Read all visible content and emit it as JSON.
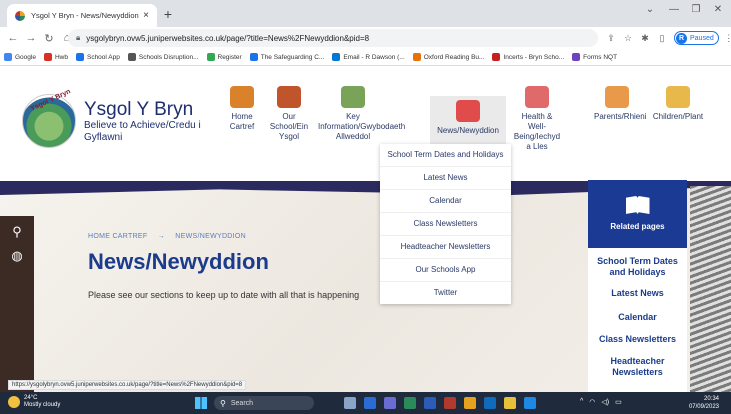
{
  "browser": {
    "tab_title": "Ysgol Y Bryn - News/Newyddion",
    "tab_close": "×",
    "new_tab": "+",
    "url": "ysgolybryn.ovw5.juniperwebsites.co.uk/page/?title=News%2FNewyddion&pid=8",
    "profile_initial": "R",
    "profile_status": "Paused",
    "win_minimize": "—",
    "win_restore": "❐",
    "win_close": "✕",
    "win_chevron": "⌄"
  },
  "bookmarks": [
    {
      "label": "Google",
      "color": "#4285f4"
    },
    {
      "label": "Hwb",
      "color": "#d93025"
    },
    {
      "label": "School App",
      "color": "#1a73e8"
    },
    {
      "label": "Schools Disruption...",
      "color": "#555555"
    },
    {
      "label": "Register",
      "color": "#34a853"
    },
    {
      "label": "The Safeguarding C...",
      "color": "#1a73e8"
    },
    {
      "label": "Email - R Dawson (...",
      "color": "#0078d4"
    },
    {
      "label": "Oxford Reading Bu...",
      "color": "#e8710a"
    },
    {
      "label": "Incerts - Bryn Scho...",
      "color": "#c5221f"
    },
    {
      "label": "Forms NQT",
      "color": "#6f42c1"
    }
  ],
  "school": {
    "name": "Ysgol Y Bryn",
    "motto": "Believe to Achieve/Credu i Gyflawni",
    "logo_text": "Ysgol Y Bryn"
  },
  "nav": [
    {
      "label": "Home Cartref",
      "icon": "house-icon",
      "color": "#d9822b"
    },
    {
      "label": "Our School/Ein Ysgol",
      "icon": "school-icon",
      "color": "#c0552b"
    },
    {
      "label": "Key Information/Gwybodaeth Allweddol",
      "icon": "document-icon",
      "color": "#7aa35a"
    },
    {
      "label": "News/Newyddion",
      "icon": "newspaper-icon",
      "color": "#e04b4b"
    },
    {
      "label": "Health & Well-Being/Iechyd a Lles",
      "icon": "heart-hand-icon",
      "color": "#e06a6a"
    },
    {
      "label": "Parents/Rhieni",
      "icon": "parents-icon",
      "color": "#e89a4a"
    },
    {
      "label": "Children/Plant",
      "icon": "children-icon",
      "color": "#e8b84a"
    }
  ],
  "dropdown": [
    "School Term Dates and Holidays",
    "Latest News",
    "Calendar",
    "Class Newsletters",
    "Headteacher Newsletters",
    "Our Schools App",
    "Twitter"
  ],
  "breadcrumb": {
    "home": "HOME CARTREF",
    "sep": "→",
    "current": "NEWS/NEWYDDION"
  },
  "page_title": "News/Newyddion",
  "intro": "Please see our sections to keep up to date with all that is happening",
  "related": {
    "heading": "Related pages",
    "items": [
      "School Term Dates and Holidays",
      "Latest News",
      "Calendar",
      "Class Newsletters",
      "Headteacher Newsletters"
    ]
  },
  "status_url": "https://ysgolybryn.ovw5.juniperwebsites.co.uk/page/?title=News%2FNewyddion&pid=8",
  "taskbar": {
    "temp": "24°C",
    "weather": "Mostly cloudy",
    "search": "Search",
    "time": "20:34",
    "date": "07/09/2023"
  }
}
